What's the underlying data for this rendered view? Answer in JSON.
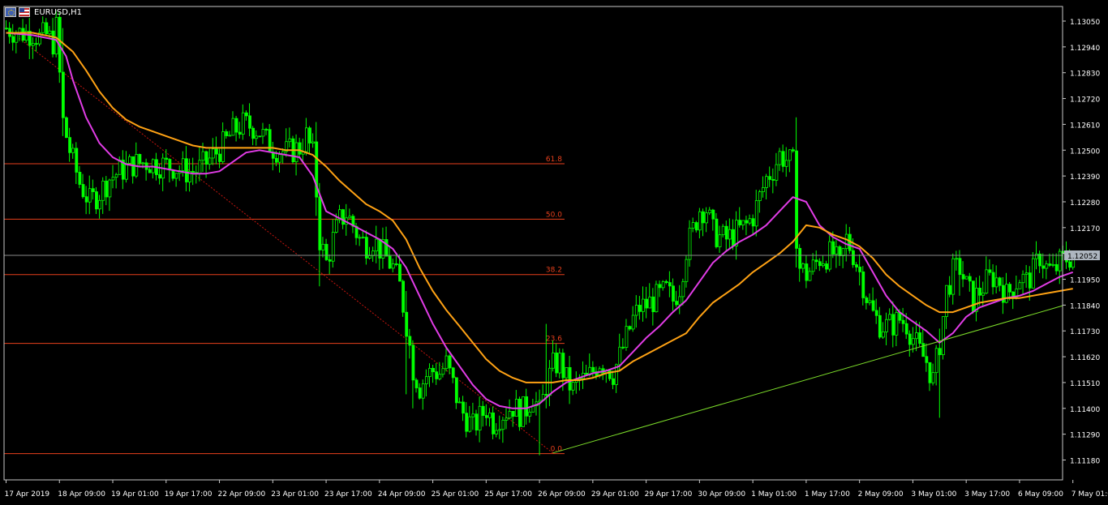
{
  "symbol": {
    "label": "EURUSD,H1",
    "base_flag": "eu-flag-icon",
    "quote_flag": "us-flag-icon"
  },
  "colors": {
    "background": "#000000",
    "bull_candle": "#00ff00",
    "bear_candle": "#00ff00",
    "ma_fast": "#e13ce6",
    "ma_slow": "#ffa214",
    "fib_levels": "#e8401c",
    "fib_trend": "#c8150e",
    "trendline": "#7dde2a",
    "price_line": "#8a8a8a",
    "axis": "#c8c8c8",
    "current_price_bg": "#aeb6c0"
  },
  "chart_data": {
    "type": "line",
    "ylim": [
      1.1113,
      1.1311
    ],
    "y_ticks": [
      "1.13050",
      "1.12940",
      "1.12830",
      "1.12720",
      "1.12610",
      "1.12500",
      "1.12390",
      "1.12280",
      "1.12170",
      "1.12060",
      "1.11950",
      "1.11840",
      "1.11730",
      "1.11620",
      "1.11510",
      "1.11400",
      "1.11290",
      "1.11180"
    ],
    "x_ticks": [
      "17 Apr 2019",
      "18 Apr 09:00",
      "19 Apr 01:00",
      "19 Apr 17:00",
      "22 Apr 09:00",
      "23 Apr 01:00",
      "23 Apr 17:00",
      "24 Apr 09:00",
      "25 Apr 01:00",
      "25 Apr 17:00",
      "26 Apr 09:00",
      "29 Apr 01:00",
      "29 Apr 17:00",
      "30 Apr 09:00",
      "1 May 01:00",
      "1 May 17:00",
      "2 May 09:00",
      "3 May 01:00",
      "3 May 17:00",
      "6 May 09:00",
      "7 May 01:00"
    ],
    "x_index": [
      0,
      16,
      32,
      48,
      64,
      80,
      96,
      112,
      128,
      144,
      160,
      176,
      192,
      208,
      224,
      240,
      256,
      272,
      288,
      304,
      320
    ],
    "current_price": "1.12052",
    "price_path": [
      [
        0,
        1.1302
      ],
      [
        4,
        1.13
      ],
      [
        8,
        1.13
      ],
      [
        10,
        1.1298
      ],
      [
        12,
        1.1299
      ],
      [
        14,
        1.1296
      ],
      [
        15,
        1.1302
      ],
      [
        17,
        1.1262
      ],
      [
        19,
        1.125
      ],
      [
        22,
        1.1236
      ],
      [
        25,
        1.1228
      ],
      [
        28,
        1.1232
      ],
      [
        31,
        1.1238
      ],
      [
        34,
        1.1241
      ],
      [
        38,
        1.1244
      ],
      [
        42,
        1.1245
      ],
      [
        46,
        1.1244
      ],
      [
        50,
        1.1243
      ],
      [
        54,
        1.1241
      ],
      [
        57,
        1.1241
      ],
      [
        61,
        1.1246
      ],
      [
        65,
        1.1252
      ],
      [
        68,
        1.1258
      ],
      [
        71,
        1.1261
      ],
      [
        74,
        1.126
      ],
      [
        76,
        1.1258
      ],
      [
        78,
        1.1254
      ],
      [
        80,
        1.1251
      ],
      [
        84,
        1.1249
      ],
      [
        88,
        1.1251
      ],
      [
        90,
        1.1256
      ],
      [
        92,
        1.1248
      ],
      [
        93,
        1.1232
      ],
      [
        94,
        1.1212
      ],
      [
        96,
        1.1202
      ],
      [
        98,
        1.1212
      ],
      [
        100,
        1.122
      ],
      [
        102,
        1.1223
      ],
      [
        104,
        1.1218
      ],
      [
        106,
        1.1212
      ],
      [
        108,
        1.121
      ],
      [
        110,
        1.1212
      ],
      [
        112,
        1.1208
      ],
      [
        114,
        1.1204
      ],
      [
        116,
        1.12
      ],
      [
        118,
        1.1192
      ],
      [
        120,
        1.1176
      ],
      [
        122,
        1.1157
      ],
      [
        124,
        1.1149
      ],
      [
        126,
        1.1154
      ],
      [
        128,
        1.1156
      ],
      [
        130,
        1.1155
      ],
      [
        132,
        1.1159
      ],
      [
        134,
        1.115
      ],
      [
        136,
        1.114
      ],
      [
        138,
        1.1136
      ],
      [
        140,
        1.1132
      ],
      [
        142,
        1.1136
      ],
      [
        144,
        1.114
      ],
      [
        146,
        1.1134
      ],
      [
        148,
        1.1137
      ],
      [
        150,
        1.1139
      ],
      [
        152,
        1.1141
      ],
      [
        154,
        1.1138
      ],
      [
        156,
        1.114
      ],
      [
        158,
        1.1146
      ],
      [
        160,
        1.1138
      ],
      [
        162,
        1.115
      ],
      [
        164,
        1.1158
      ],
      [
        166,
        1.116
      ],
      [
        168,
        1.1152
      ],
      [
        170,
        1.1148
      ],
      [
        172,
        1.1152
      ],
      [
        174,
        1.1152
      ],
      [
        176,
        1.1156
      ],
      [
        178,
        1.116
      ],
      [
        180,
        1.1158
      ],
      [
        182,
        1.1155
      ],
      [
        184,
        1.1162
      ],
      [
        186,
        1.117
      ],
      [
        188,
        1.1178
      ],
      [
        190,
        1.1183
      ],
      [
        192,
        1.1184
      ],
      [
        194,
        1.1186
      ],
      [
        196,
        1.1188
      ],
      [
        198,
        1.119
      ],
      [
        200,
        1.1186
      ],
      [
        202,
        1.1192
      ],
      [
        204,
        1.1208
      ],
      [
        206,
        1.1216
      ],
      [
        208,
        1.1225
      ],
      [
        210,
        1.1225
      ],
      [
        212,
        1.1215
      ],
      [
        214,
        1.1213
      ],
      [
        216,
        1.1212
      ],
      [
        218,
        1.1214
      ],
      [
        220,
        1.1216
      ],
      [
        222,
        1.1218
      ],
      [
        224,
        1.1222
      ],
      [
        226,
        1.123
      ],
      [
        228,
        1.1238
      ],
      [
        230,
        1.1242
      ],
      [
        232,
        1.1248
      ],
      [
        234,
        1.1246
      ],
      [
        236,
        1.1244
      ],
      [
        237,
        1.1214
      ],
      [
        238,
        1.12
      ],
      [
        240,
        1.1197
      ],
      [
        242,
        1.12
      ],
      [
        244,
        1.1204
      ],
      [
        246,
        1.1205
      ],
      [
        248,
        1.1206
      ],
      [
        250,
        1.12
      ],
      [
        252,
        1.1212
      ],
      [
        254,
        1.1206
      ],
      [
        256,
        1.1198
      ],
      [
        258,
        1.1188
      ],
      [
        260,
        1.118
      ],
      [
        262,
        1.1176
      ],
      [
        264,
        1.1175
      ],
      [
        266,
        1.1176
      ],
      [
        268,
        1.1178
      ],
      [
        270,
        1.1176
      ],
      [
        272,
        1.117
      ],
      [
        274,
        1.1164
      ],
      [
        276,
        1.116
      ],
      [
        278,
        1.1152
      ],
      [
        280,
        1.1168
      ],
      [
        282,
        1.119
      ],
      [
        284,
        1.1198
      ],
      [
        286,
        1.12
      ],
      [
        288,
        1.1192
      ],
      [
        290,
        1.1186
      ],
      [
        292,
        1.119
      ],
      [
        294,
        1.1194
      ],
      [
        296,
        1.1196
      ],
      [
        298,
        1.1194
      ],
      [
        300,
        1.1188
      ],
      [
        302,
        1.1192
      ],
      [
        304,
        1.1196
      ],
      [
        306,
        1.1194
      ],
      [
        308,
        1.1198
      ],
      [
        310,
        1.1205
      ],
      [
        312,
        1.12
      ],
      [
        314,
        1.1198
      ],
      [
        316,
        1.1202
      ],
      [
        318,
        1.1204
      ],
      [
        320,
        1.1205
      ]
    ],
    "series": [
      {
        "kind": "ma_fast",
        "x": [
          0,
          8,
          15,
          18,
          20,
          24,
          28,
          32,
          36,
          40,
          44,
          48,
          52,
          56,
          60,
          64,
          68,
          72,
          76,
          80,
          84,
          88,
          92,
          96,
          100,
          104,
          108,
          112,
          116,
          120,
          124,
          128,
          132,
          136,
          140,
          144,
          148,
          152,
          156,
          160,
          164,
          168,
          172,
          176,
          180,
          184,
          188,
          192,
          196,
          200,
          204,
          208,
          212,
          216,
          220,
          224,
          228,
          232,
          236,
          240,
          244,
          248,
          252,
          256,
          260,
          264,
          268,
          272,
          276,
          280,
          284,
          288,
          292,
          296,
          300,
          304,
          308,
          312,
          316,
          320
        ],
        "values": [
          1.13,
          1.1299,
          1.1297,
          1.129,
          1.128,
          1.1264,
          1.1253,
          1.1247,
          1.1244,
          1.1243,
          1.1243,
          1.1242,
          1.1241,
          1.124,
          1.124,
          1.1241,
          1.1245,
          1.1249,
          1.125,
          1.1249,
          1.1248,
          1.1247,
          1.1239,
          1.1224,
          1.1221,
          1.1218,
          1.1215,
          1.1212,
          1.1208,
          1.12,
          1.1188,
          1.1176,
          1.1166,
          1.1158,
          1.115,
          1.1144,
          1.1141,
          1.114,
          1.114,
          1.1142,
          1.1147,
          1.1151,
          1.1153,
          1.1155,
          1.1156,
          1.1158,
          1.1164,
          1.117,
          1.1175,
          1.1181,
          1.1186,
          1.1194,
          1.1202,
          1.1207,
          1.1211,
          1.1214,
          1.1218,
          1.1224,
          1.123,
          1.1228,
          1.1218,
          1.1213,
          1.121,
          1.1208,
          1.1198,
          1.1188,
          1.1181,
          1.1177,
          1.1173,
          1.1168,
          1.1172,
          1.1179,
          1.1183,
          1.1185,
          1.1187,
          1.1188,
          1.119,
          1.1193,
          1.1196,
          1.1198
        ]
      },
      {
        "kind": "ma_slow",
        "x": [
          0,
          8,
          15,
          20,
          24,
          28,
          32,
          36,
          40,
          44,
          48,
          52,
          56,
          60,
          64,
          68,
          72,
          76,
          80,
          84,
          88,
          92,
          96,
          100,
          104,
          108,
          112,
          116,
          120,
          124,
          128,
          132,
          136,
          140,
          144,
          148,
          152,
          156,
          160,
          164,
          168,
          172,
          176,
          180,
          184,
          188,
          192,
          196,
          200,
          204,
          208,
          212,
          216,
          220,
          224,
          228,
          232,
          236,
          240,
          244,
          248,
          252,
          256,
          260,
          264,
          268,
          272,
          276,
          280,
          284,
          288,
          292,
          296,
          300,
          304,
          308,
          312,
          316,
          320
        ],
        "values": [
          1.13,
          1.13,
          1.1298,
          1.1292,
          1.1284,
          1.1275,
          1.1268,
          1.1263,
          1.126,
          1.1258,
          1.1256,
          1.1254,
          1.1252,
          1.1251,
          1.1251,
          1.1251,
          1.1251,
          1.1251,
          1.1251,
          1.125,
          1.125,
          1.1248,
          1.1243,
          1.1237,
          1.1232,
          1.1227,
          1.1224,
          1.122,
          1.1212,
          1.12,
          1.119,
          1.1182,
          1.1175,
          1.1168,
          1.1161,
          1.1156,
          1.1153,
          1.1151,
          1.1151,
          1.1151,
          1.1152,
          1.1152,
          1.1153,
          1.1155,
          1.1156,
          1.116,
          1.1163,
          1.1166,
          1.1169,
          1.1172,
          1.1179,
          1.1185,
          1.1189,
          1.1193,
          1.1198,
          1.1202,
          1.1206,
          1.1211,
          1.1218,
          1.1217,
          1.1214,
          1.1212,
          1.1209,
          1.1204,
          1.1197,
          1.1192,
          1.1188,
          1.1184,
          1.1181,
          1.1181,
          1.1183,
          1.1185,
          1.1186,
          1.1187,
          1.1187,
          1.1188,
          1.1189,
          1.119,
          1.1191
        ]
      }
    ],
    "fib_levels": [
      {
        "label": "61.8",
        "price": 1.12442
      },
      {
        "label": "50.0",
        "price": 1.12206
      },
      {
        "label": "38.2",
        "price": 1.1197
      },
      {
        "label": "23.6",
        "price": 1.11677
      },
      {
        "label": "0.0",
        "price": 1.11207
      }
    ],
    "fib_x_range": [
      0,
      168
    ],
    "fib_trend": {
      "x": [
        0,
        164
      ],
      "values": [
        1.1302,
        1.1121
      ]
    },
    "trendline": {
      "x": [
        164,
        320
      ],
      "values": [
        1.1121,
        1.1185
      ]
    },
    "grid": false
  }
}
